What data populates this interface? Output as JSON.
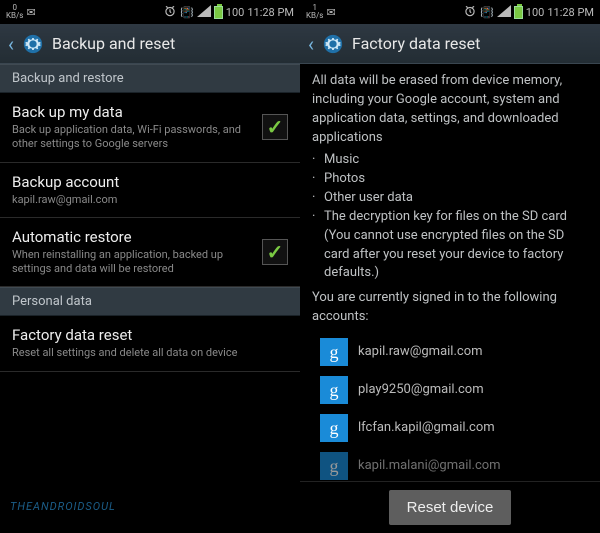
{
  "left": {
    "status": {
      "kbs_num": "0",
      "kbs_unit": "KB/s",
      "battery": "100",
      "time": "11:28 PM"
    },
    "title": "Backup and reset",
    "sections": {
      "backup_restore": "Backup and restore",
      "personal_data": "Personal data"
    },
    "items": {
      "backup_data": {
        "title": "Back up my data",
        "sub": "Back up application data, Wi-Fi passwords, and other settings to Google servers",
        "checked": true
      },
      "backup_account": {
        "title": "Backup account",
        "sub": "kapil.raw@gmail.com"
      },
      "auto_restore": {
        "title": "Automatic restore",
        "sub": "When reinstalling an application, backed up settings and data will be restored",
        "checked": true
      },
      "factory_reset": {
        "title": "Factory data reset",
        "sub": "Reset all settings and delete all data on device"
      }
    },
    "watermark": "THEANDROIDSOUL"
  },
  "right": {
    "status": {
      "kbs_num": "1",
      "kbs_unit": "KB/s",
      "battery": "100",
      "time": "11:28 PM"
    },
    "title": "Factory data reset",
    "warning_body": "All data will be erased from device memory, including your Google account, system and application data, settings, and downloaded applications",
    "bullets": {
      "b1": "Music",
      "b2": "Photos",
      "b3": "Other user data",
      "b4": "The decryption key for files on the SD card",
      "b4_note": "(You cannot use encrypted files on the SD card after you reset your device to factory defaults.)"
    },
    "signed_in_text": "You are currently signed in to the following accounts:",
    "accounts": {
      "a1": "kapil.raw@gmail.com",
      "a2": "play9250@gmail.com",
      "a3": "lfcfan.kapil@gmail.com",
      "a4": "kapil.malani@gmail.com"
    },
    "reset_button": "Reset device"
  }
}
